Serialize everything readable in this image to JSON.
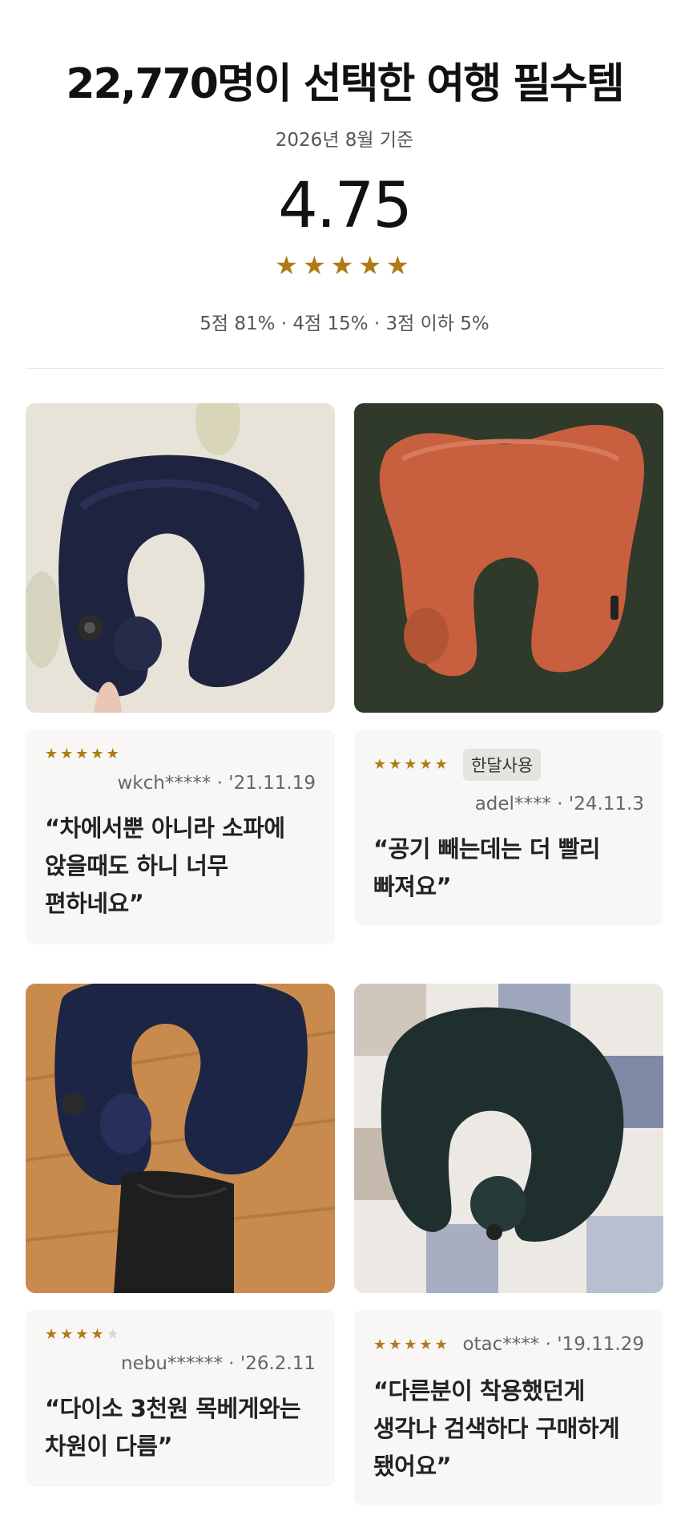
{
  "header": {
    "title": "22,770명이 선택한 여행 필수템",
    "subtitle": "2026년 8월 기준",
    "rating": "4.75",
    "rating_stars": 4.75,
    "distribution": "5점 81% · 4점 15% · 3점 이하 5%"
  },
  "colors": {
    "star": "#b07a15",
    "star_empty": "#d8d8d8",
    "card_bg": "#f8f7f5"
  },
  "reviews": [
    {
      "photo": "navy-neck-pillow-photo",
      "stars": 5,
      "tag": "",
      "user": "wkch*****",
      "date": "'21.11.19",
      "quote_lines": [
        "“차에서뿐 아니라 소파에",
        "앉을때도 하니 너무",
        "편하네요”"
      ]
    },
    {
      "photo": "orange-neck-pillow-photo",
      "stars": 5,
      "tag": "한달사용",
      "user": "adel****",
      "date": "'24.11.3",
      "quote_lines": [
        "“공기 빼는데는 더 빨리",
        "빠져요”"
      ]
    },
    {
      "photo": "navy-pillow-with-pouch-photo",
      "stars": 4,
      "tag": "",
      "user": "nebu******",
      "date": "'26.2.11",
      "quote_lines": [
        "“다이소 3천원 목베게와는",
        "차원이 다름”"
      ]
    },
    {
      "photo": "dark-green-neck-pillow-photo",
      "stars": 5,
      "tag": "",
      "user": "otac****",
      "date": "'19.11.29",
      "quote_lines": [
        "“다른분이 착용했던게",
        "생각나 검색하다 구매하게",
        "됐어요”"
      ]
    }
  ]
}
